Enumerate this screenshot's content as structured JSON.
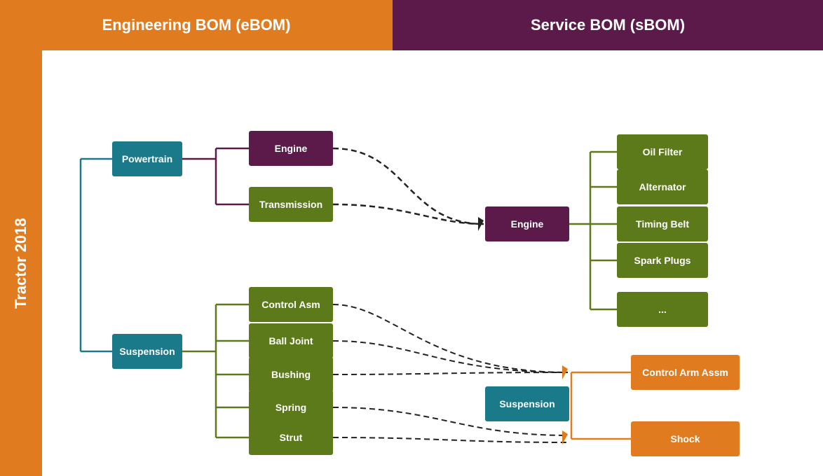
{
  "header": {
    "ebom_label": "Engineering BOM (eBOM)",
    "sbom_label": "Service BOM (sBOM)"
  },
  "tractor_label": "Tractor 2018",
  "nodes": {
    "powertrain": "Powertrain",
    "suspension_ebom": "Suspension",
    "engine_ebom": "Engine",
    "transmission": "Transmission",
    "control_asm": "Control Asm",
    "ball_joint": "Ball Joint",
    "bushing": "Bushing",
    "spring": "Spring",
    "strut": "Strut",
    "engine_sbom": "Engine",
    "suspension_sbom": "Suspension",
    "oil_filter": "Oil Filter",
    "alternator": "Alternator",
    "timing_belt": "Timing Belt",
    "spark_plugs": "Spark Plugs",
    "ellipsis": "...",
    "control_arm_assm": "Control Arm Assm",
    "shock": "Shock"
  }
}
